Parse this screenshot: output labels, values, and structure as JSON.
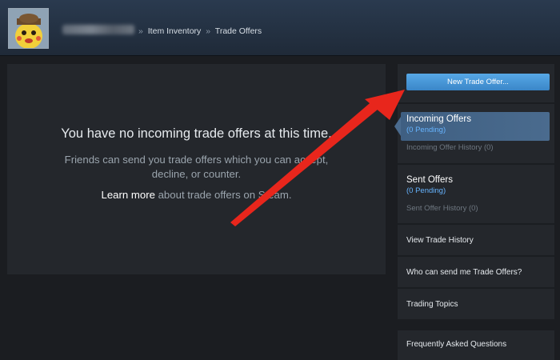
{
  "header": {
    "breadcrumbs": [
      "Item Inventory",
      "Trade Offers"
    ],
    "separator": "»"
  },
  "main": {
    "title": "You have no incoming trade offers at this time.",
    "body_line1": "Friends can send you trade offers which you can accept,",
    "body_line2": "decline, or counter.",
    "learn_more": "Learn more",
    "learn_more_rest": " about trade offers on Steam."
  },
  "sidebar": {
    "new_offer_label": "New Trade Offer...",
    "incoming_title": "Incoming Offers",
    "incoming_pending": "(0 Pending)",
    "incoming_history": "Incoming Offer History (0)",
    "sent_title": "Sent Offers",
    "sent_pending": "(0 Pending)",
    "sent_history": "Sent Offer History (0)",
    "view_history": "View Trade History",
    "who_can_send": "Who can send me Trade Offers?",
    "trading_topics": "Trading Topics",
    "faq": "Frequently Asked Questions"
  },
  "colors": {
    "accent_button": "#4a9ad8",
    "selected_tab": "#4a6b8e",
    "pending_text": "#66b4ff",
    "annotation_arrow": "#e8261c"
  }
}
